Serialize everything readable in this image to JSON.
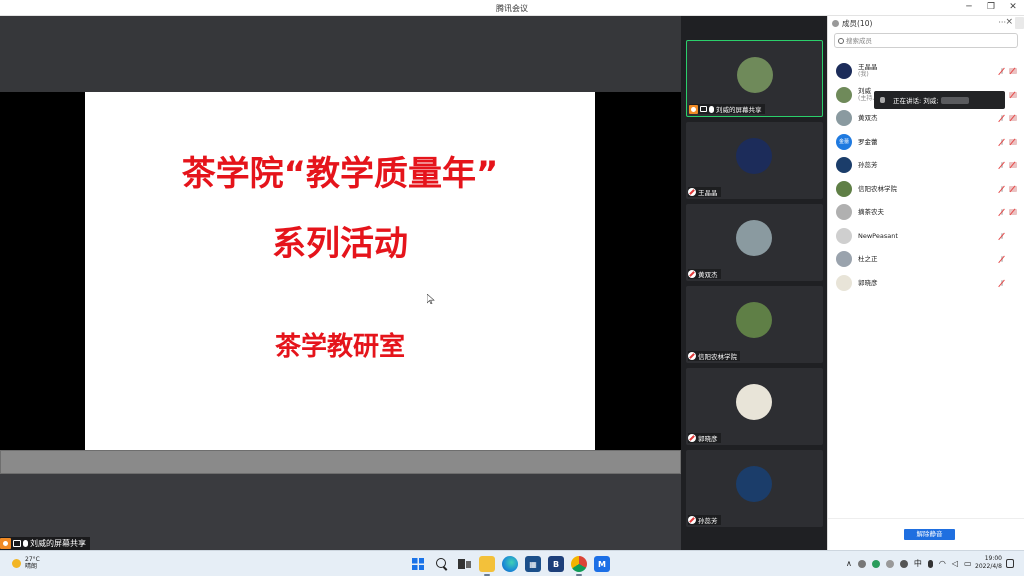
{
  "window": {
    "title": "腾讯会议"
  },
  "share": {
    "slide_line1": "茶学院“教学质量年”",
    "slide_line2": "系列活动",
    "slide_line3": "茶学教研室",
    "sharer_label": "刘威的屏幕共享"
  },
  "video_tiles": [
    {
      "name": "刘威的屏幕共享",
      "avatar_color": "#6f8a5a",
      "active": true
    },
    {
      "name": "王晶晶",
      "avatar_color": "#1c2c5a"
    },
    {
      "name": "黄双杰",
      "avatar_color": "#8a9aa0"
    },
    {
      "name": "信阳农林学院",
      "avatar_color": "#5f7f46"
    },
    {
      "name": "郭晓彦",
      "avatar_color": "#e8e4d8"
    },
    {
      "name": "孙蕊芳",
      "avatar_color": "#1b3d6a"
    }
  ],
  "members_panel": {
    "header": "成员(10)",
    "more_glyph": "···",
    "close_glyph": "×",
    "search_placeholder": "搜索成员",
    "unmute_all_label": "解除静音",
    "members": [
      {
        "name": "王晶晶",
        "sub": "(我)",
        "avatar_color": "#1c2c5a",
        "video": true
      },
      {
        "name": "刘威",
        "sub": "(主持人",
        "avatar_color": "#6f8a5a",
        "video": true
      },
      {
        "name": "黄双杰",
        "sub": "",
        "avatar_color": "#8a9aa0",
        "video": true
      },
      {
        "name": "罗金蕾",
        "sub": "",
        "avatar_color": "#1f7ae0",
        "avatar_text": "金蕾",
        "video": true
      },
      {
        "name": "孙蕊芳",
        "sub": "",
        "avatar_color": "#1b3d6a",
        "video": true
      },
      {
        "name": "信阳农林学院",
        "sub": "",
        "avatar_color": "#5f7f46",
        "video": true
      },
      {
        "name": "摘茶农夫",
        "sub": "",
        "avatar_color": "#b0b0b0",
        "video": true
      },
      {
        "name": "NewPeasant",
        "sub": "",
        "avatar_color": "#cfcfcf",
        "video": false
      },
      {
        "name": "杜之正",
        "sub": "",
        "avatar_color": "#9aa3ad",
        "video": false
      },
      {
        "name": "郭晓彦",
        "sub": "",
        "avatar_color": "#e8e4d8",
        "video": false
      }
    ],
    "speaking_tooltip": "正在讲话: 刘威;"
  },
  "taskbar": {
    "weather_temp": "27°C",
    "weather_desc": "晴朗",
    "store_glyph": "▦",
    "bapp_glyph": "B",
    "meeting_glyph": "M",
    "tray_expand": "∧",
    "tray_lang": "中",
    "tray_wifi": "◠",
    "tray_volume": "◁",
    "tray_battery": "▭",
    "time": "19:00",
    "date": "2022/4/8"
  }
}
